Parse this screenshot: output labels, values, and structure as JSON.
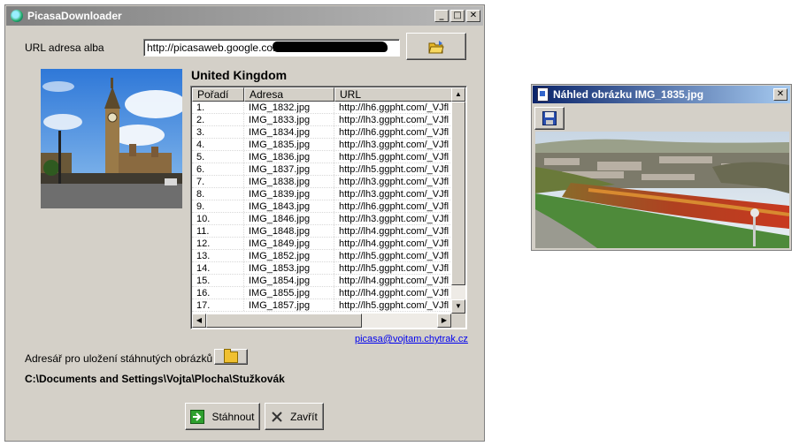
{
  "main_window": {
    "title": "PicasaDownloader",
    "title_buttons": {
      "minimize": "_",
      "maximize": "□",
      "close": "✕"
    },
    "url_label": "URL adresa alba",
    "url_value": "http://picasaweb.google.com",
    "album_title": "United Kingdom",
    "table": {
      "columns": [
        "Pořadí",
        "Adresa",
        "URL"
      ],
      "rows": [
        [
          "1.",
          "IMG_1832.jpg",
          "http://lh6.ggpht.com/_VJfl"
        ],
        [
          "2.",
          "IMG_1833.jpg",
          "http://lh3.ggpht.com/_VJfl"
        ],
        [
          "3.",
          "IMG_1834.jpg",
          "http://lh6.ggpht.com/_VJfl"
        ],
        [
          "4.",
          "IMG_1835.jpg",
          "http://lh3.ggpht.com/_VJfl"
        ],
        [
          "5.",
          "IMG_1836.jpg",
          "http://lh5.ggpht.com/_VJfl"
        ],
        [
          "6.",
          "IMG_1837.jpg",
          "http://lh5.ggpht.com/_VJfl"
        ],
        [
          "7.",
          "IMG_1838.jpg",
          "http://lh3.ggpht.com/_VJfl"
        ],
        [
          "8.",
          "IMG_1839.jpg",
          "http://lh3.ggpht.com/_VJfl"
        ],
        [
          "9.",
          "IMG_1843.jpg",
          "http://lh6.ggpht.com/_VJfl"
        ],
        [
          "10.",
          "IMG_1846.jpg",
          "http://lh3.ggpht.com/_VJfl"
        ],
        [
          "11.",
          "IMG_1848.jpg",
          "http://lh4.ggpht.com/_VJfl"
        ],
        [
          "12.",
          "IMG_1849.jpg",
          "http://lh4.ggpht.com/_VJfl"
        ],
        [
          "13.",
          "IMG_1852.jpg",
          "http://lh5.ggpht.com/_VJfl"
        ],
        [
          "14.",
          "IMG_1853.jpg",
          "http://lh5.ggpht.com/_VJfl"
        ],
        [
          "15.",
          "IMG_1854.jpg",
          "http://lh4.ggpht.com/_VJfl"
        ],
        [
          "16.",
          "IMG_1855.jpg",
          "http://lh4.ggpht.com/_VJfl"
        ],
        [
          "17.",
          "IMG_1857.jpg",
          "http://lh5.ggpht.com/_VJfl"
        ]
      ]
    },
    "email_link": "picasa@vojtam.chytrak.cz",
    "folder_label": "Adresář pro uložení stáhnutých obrázků",
    "folder_path": "C:\\Documents and Settings\\Vojta\\Plocha\\Stužkovák",
    "download_button": "Stáhnout",
    "close_button": "Zavřít"
  },
  "preview_window": {
    "title": "Náhled obrázku IMG_1835.jpg",
    "close_glyph": "✕"
  },
  "icons": [
    "app-icon",
    "folder-open-icon",
    "folder-browse-icon",
    "save-disk-icon",
    "green-arrow-icon",
    "close-x-icon",
    "document-image-icon"
  ],
  "colors": {
    "window_face": "#d4d0c8",
    "inactive_title": "#808080",
    "active_title": "#0a246a",
    "link": "#0000ee"
  }
}
